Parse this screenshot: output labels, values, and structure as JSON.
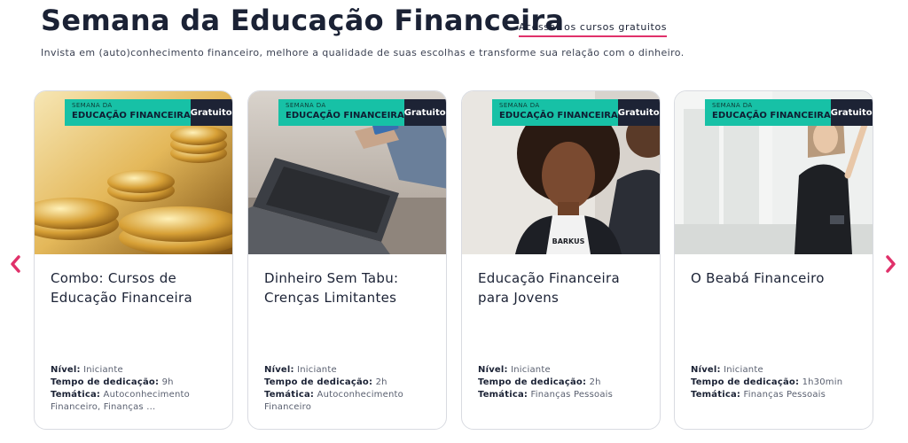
{
  "header": {
    "title": "Semana da Educação Financeira",
    "cta_label": "Acessar os cursos gratuitos",
    "subtitle": "Invista em (auto)conhecimento financeiro, melhore a qualidade de suas escolhas e transforme sua relação com o dinheiro."
  },
  "carousel": {
    "prev_icon": "chevron-left-icon",
    "next_icon": "chevron-right-icon",
    "accent_color": "#e0316a"
  },
  "banner": {
    "top": "SEMANA DA",
    "bottom": "EDUCAÇÃO FINANCEIRA",
    "badge": "Gratuito",
    "color": "#17c1a6",
    "badge_color": "#1d2335"
  },
  "meta_labels": {
    "level": "Nível:",
    "time": "Tempo de dedicação:",
    "theme": "Temática:"
  },
  "cards": [
    {
      "title": "Combo: Cursos de Educação Financeira",
      "level": "Iniciante",
      "time": "9h",
      "theme": "Autoconhecimento Financeiro, Finanças ..."
    },
    {
      "title": "Dinheiro Sem Tabu: Crenças Limitantes",
      "level": "Iniciante",
      "time": "2h",
      "theme": "Autoconhecimento Financeiro"
    },
    {
      "title": "Educação Financeira para Jovens",
      "level": "Iniciante",
      "time": "2h",
      "theme": "Finanças Pessoais",
      "image_text": "BARKUS"
    },
    {
      "title": "O Beabá Financeiro",
      "level": "Iniciante",
      "time": "1h30min",
      "theme": "Finanças Pessoais"
    }
  ]
}
